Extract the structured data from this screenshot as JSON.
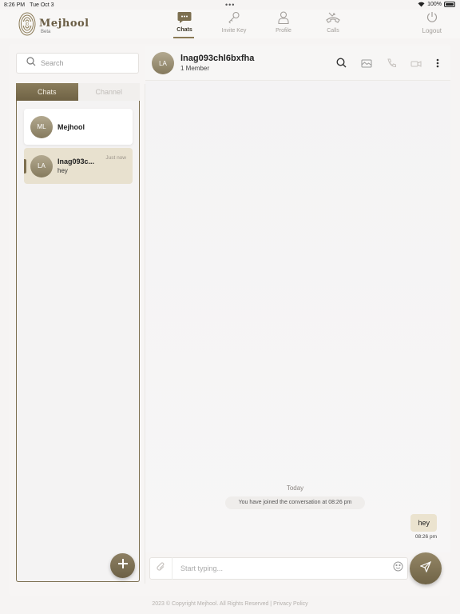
{
  "status_bar": {
    "time": "8:26 PM",
    "date": "Tue Oct 3",
    "battery": "100%"
  },
  "app": {
    "brand": "Mejhool",
    "badge": "Beta"
  },
  "nav": {
    "items": [
      {
        "label": "Chats",
        "icon": "chat-bubble-icon",
        "active": true
      },
      {
        "label": "Invite Key",
        "icon": "key-icon",
        "active": false
      },
      {
        "label": "Profile",
        "icon": "user-icon",
        "active": false
      },
      {
        "label": "Calls",
        "icon": "phone-missed-icon",
        "active": false
      }
    ],
    "logout_label": "Logout"
  },
  "sidebar": {
    "search_placeholder": "Search",
    "tabs": [
      {
        "label": "Chats",
        "active": true
      },
      {
        "label": "Channel",
        "active": false
      }
    ],
    "chats": [
      {
        "initials": "ML",
        "name": "Mejhool",
        "preview": "",
        "time": ""
      },
      {
        "initials": "LA",
        "name": "lnag093c...",
        "preview": "hey",
        "time": "Just now"
      }
    ]
  },
  "conversation": {
    "initials": "LA",
    "title": "lnag093chl6bxfha",
    "subtitle": "1 Member",
    "day_label": "Today",
    "system_message": "You have joined the conversation at 08:26 pm",
    "messages": [
      {
        "text": "hey",
        "time": "08:26 pm",
        "outgoing": true
      }
    ],
    "composer_placeholder": "Start typing..."
  },
  "footer": {
    "copyright": "2023 © Copyright Mejhool. All Rights Reserved |",
    "privacy": "Privacy Policy"
  },
  "colors": {
    "accent": "#7c6f50",
    "bubble": "#ebe3cf",
    "active_chat": "#e8e1cf"
  }
}
